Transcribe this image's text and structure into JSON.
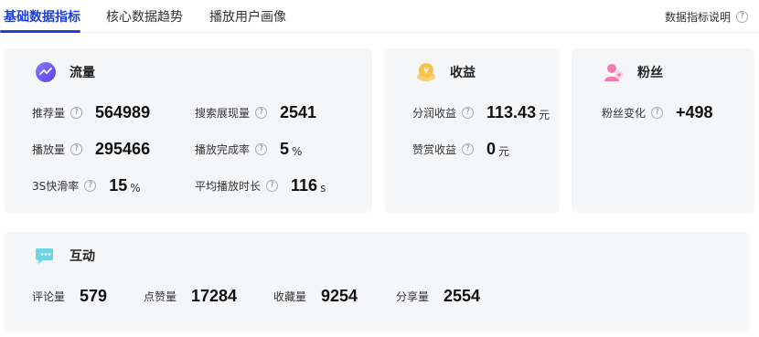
{
  "tabs": [
    {
      "label": "基础数据指标",
      "active": true
    },
    {
      "label": "核心数据趋势",
      "active": false
    },
    {
      "label": "播放用户画像",
      "active": false
    }
  ],
  "help_link": {
    "label": "数据指标说明",
    "icon": "question-circle-icon"
  },
  "colors": {
    "accent": "#1f3fd6",
    "card_bg": "#f5f6f8"
  },
  "traffic": {
    "title": "流量",
    "icon": "traffic-icon",
    "metrics": [
      {
        "label": "推荐量",
        "value": "564989",
        "unit": ""
      },
      {
        "label": "搜索展现量",
        "value": "2541",
        "unit": ""
      },
      {
        "label": "播放量",
        "value": "295466",
        "unit": ""
      },
      {
        "label": "播放完成率",
        "value": "5",
        "unit": "%"
      },
      {
        "label": "3S快滑率",
        "value": "15",
        "unit": "%"
      },
      {
        "label": "平均播放时长",
        "value": "116",
        "unit": "s"
      }
    ]
  },
  "income": {
    "title": "收益",
    "icon": "money-icon",
    "metrics": [
      {
        "label": "分润收益",
        "value": "113.43",
        "unit": "元"
      },
      {
        "label": "赞赏收益",
        "value": "0",
        "unit": "元"
      }
    ]
  },
  "fans": {
    "title": "粉丝",
    "icon": "fans-icon",
    "metrics": [
      {
        "label": "粉丝变化",
        "value": "+498",
        "unit": ""
      }
    ]
  },
  "interaction": {
    "title": "互动",
    "icon": "chat-icon",
    "metrics": [
      {
        "label": "评论量",
        "value": "579"
      },
      {
        "label": "点赞量",
        "value": "17284"
      },
      {
        "label": "收藏量",
        "value": "9254"
      },
      {
        "label": "分享量",
        "value": "2554"
      }
    ]
  }
}
